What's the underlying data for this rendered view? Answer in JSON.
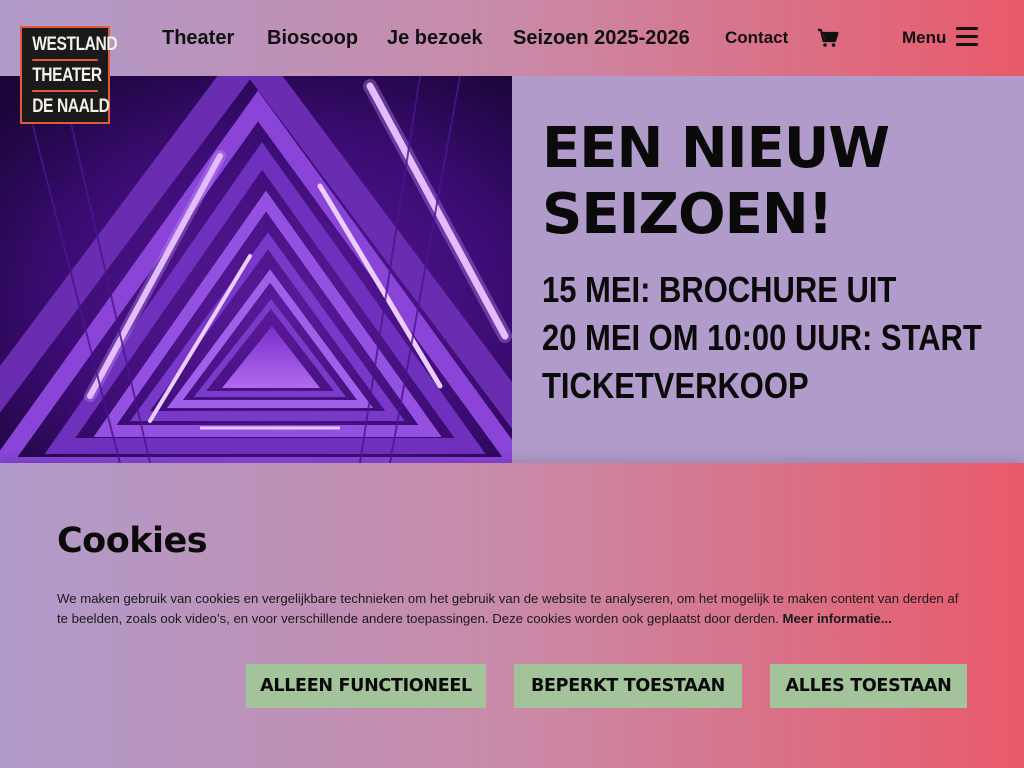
{
  "logo": {
    "lines": [
      "WESTLAND",
      "THEATER",
      "DE NAALD"
    ]
  },
  "nav": {
    "links": [
      "Theater",
      "Bioscoop",
      "Je bezoek",
      "Seizoen 2025-2026"
    ],
    "contact": "Contact",
    "cart_icon": "shopping-cart-icon",
    "menu_label": "Menu",
    "menu_icon": "hamburger-icon"
  },
  "hero": {
    "title_lines": [
      "EEN NIEUW",
      "SEIZOEN!"
    ],
    "lines": [
      "15 MEI: BROCHURE UIT",
      "20 MEI OM 10:00 UUR: START",
      "TICKETVERKOOP"
    ]
  },
  "cookies": {
    "title": "Cookies",
    "text": "We maken gebruik van cookies en vergelijkbare technieken om het gebruik van de website te analyseren, om het mogelijk te maken content van derden af te beelden, zoals ook video’s, en voor verschillende andere toepassingen. Deze cookies worden ook geplaatst door derden.",
    "more_link": "Meer informatie...",
    "buttons": {
      "functional": "Alleen functioneel",
      "limited": "Beperkt toestaan",
      "all": "Alles toestaan"
    }
  },
  "colors": {
    "header_gradient_start": "#b09bcb",
    "header_gradient_end": "#e95a6a",
    "hero_panel": "#b09bcb",
    "button_bg": "#a3c39a",
    "logo_accent": "#e25a3a"
  }
}
